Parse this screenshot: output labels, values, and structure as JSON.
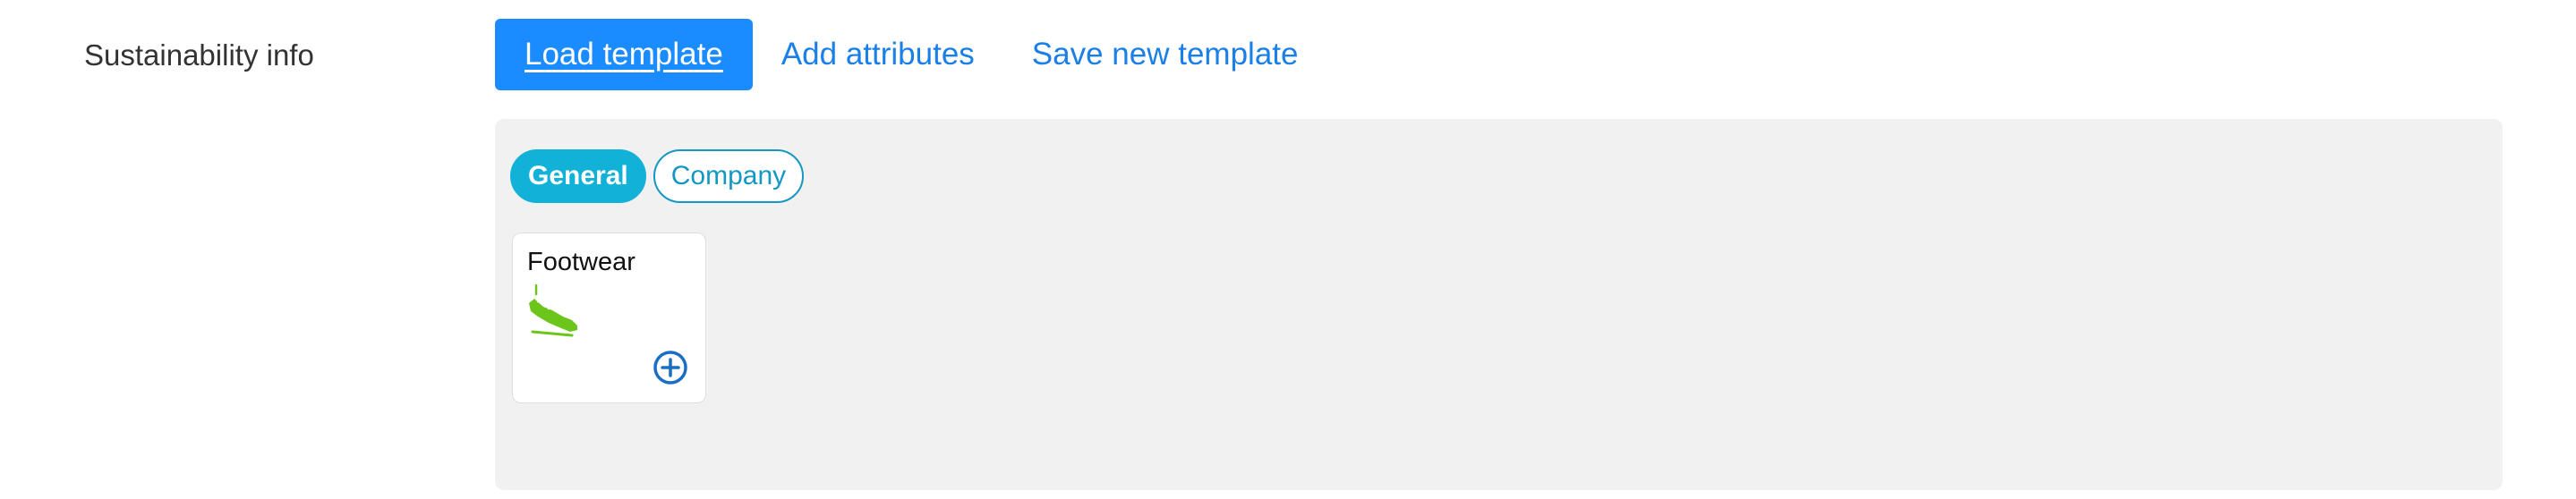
{
  "section": {
    "label": "Sustainability info"
  },
  "toolbar": {
    "load_label": "Load template",
    "add_label": "Add attributes",
    "save_label": "Save new template"
  },
  "tabs": [
    {
      "label": "General",
      "active": true
    },
    {
      "label": "Company",
      "active": false
    }
  ],
  "cards": [
    {
      "title": "Footwear",
      "icon": "shoe-icon",
      "action_icon": "add-circle-icon"
    }
  ],
  "colors": {
    "primary": "#1a8cff",
    "link": "#1a7fe6",
    "tab_active": "#12b1d8",
    "tab_outline": "#1497c3",
    "panel_bg": "#f1f1f1",
    "shoe_green": "#6cc51a"
  }
}
